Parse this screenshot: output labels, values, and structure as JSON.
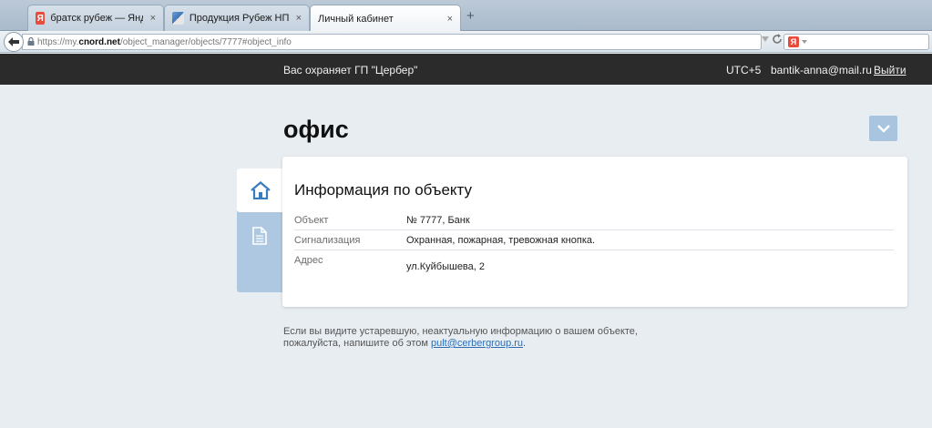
{
  "browser": {
    "tabs": [
      {
        "label": "братск рубеж — Яндекс: ...",
        "favicon": "yandex-icon"
      },
      {
        "label": "Продукция Рубеж НПО",
        "favicon": "rubezh-icon"
      },
      {
        "label": "Личный кабинет",
        "favicon": ""
      }
    ],
    "close_glyph": "×",
    "new_tab_glyph": "+",
    "url": {
      "prefix": "https://my.",
      "domain": "cnord.net",
      "path": "/object_manager/objects/7777#object_info"
    },
    "search_brand": "Я"
  },
  "header": {
    "protected_by": "Вас охраняет ГП \"Цербер\"",
    "timezone": "UTC+5",
    "email": "bantik-anna@mail.ru",
    "logout": "Выйти"
  },
  "page": {
    "title": "офис"
  },
  "card": {
    "title": "Информация по объекту",
    "rows": [
      {
        "key": "Объект",
        "value": "№ 7777, Банк"
      },
      {
        "key": "Сигнализация",
        "value": "Охранная, пожарная, тревожная кнопка."
      },
      {
        "key": "Адрес",
        "value": "ул.Куйбышева, 2"
      }
    ]
  },
  "notice": {
    "line1": "Если вы видите устаревшую, неактуальную информацию о вашем объекте,",
    "line2_prefix": "пожалуйста, напишите об этом ",
    "email": "pult@cerbergroup.ru",
    "line2_suffix": "."
  },
  "colors": {
    "header_bg": "#2b2b2b",
    "page_bg": "#e8edf2",
    "accent": "#a9c4de",
    "link": "#2f6db3"
  }
}
